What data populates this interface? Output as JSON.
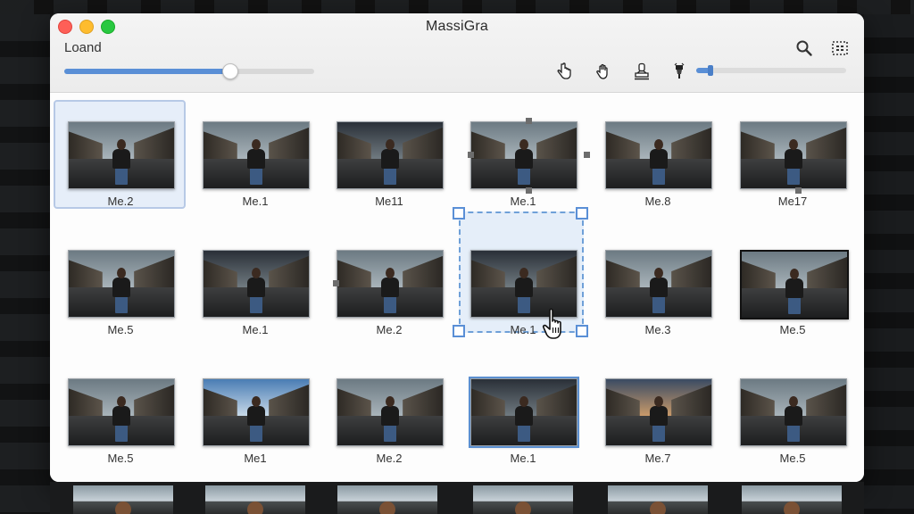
{
  "window": {
    "title": "MassiGra",
    "load_label": "Loand",
    "load_progress": 0.66,
    "zoom_level": 0.08
  },
  "toolbar": {
    "top_icons": [
      "search-icon",
      "grid-select-icon"
    ],
    "tools": [
      "hand-pointer-icon",
      "hand-grab-icon",
      "stamp-icon",
      "brush-icon"
    ]
  },
  "grid": {
    "rows": [
      [
        {
          "caption": "Me.2",
          "tone": "normal",
          "state": "selected"
        },
        {
          "caption": "Me.1",
          "tone": "normal",
          "state": "none"
        },
        {
          "caption": "Me11",
          "tone": "dark",
          "state": "none"
        },
        {
          "caption": "Me.1",
          "tone": "normal",
          "state": "handles"
        },
        {
          "caption": "Me.8",
          "tone": "normal",
          "state": "none"
        },
        {
          "caption": "Me17",
          "tone": "normal",
          "state": "handles-bottom"
        }
      ],
      [
        {
          "caption": "Me.5",
          "tone": "normal",
          "state": "none"
        },
        {
          "caption": "Me.1",
          "tone": "dark",
          "state": "none"
        },
        {
          "caption": "Me.2",
          "tone": "normal",
          "state": "handles-left"
        },
        {
          "caption": "Me.1",
          "tone": "dark",
          "state": "dashed"
        },
        {
          "caption": "Me.3",
          "tone": "normal",
          "state": "none"
        },
        {
          "caption": "Me.5",
          "tone": "normal",
          "state": "black-border"
        }
      ],
      [
        {
          "caption": "Me.5",
          "tone": "normal",
          "state": "none"
        },
        {
          "caption": "Me1",
          "tone": "blue",
          "state": "none"
        },
        {
          "caption": "Me.2",
          "tone": "normal",
          "state": "none"
        },
        {
          "caption": "Me.1",
          "tone": "dark",
          "state": "blue-border"
        },
        {
          "caption": "Me.7",
          "tone": "warm",
          "state": "none"
        },
        {
          "caption": "Me.5",
          "tone": "normal",
          "state": "none"
        }
      ]
    ]
  },
  "colors": {
    "accent": "#5a8fd6",
    "selection": "#e6eef9"
  }
}
